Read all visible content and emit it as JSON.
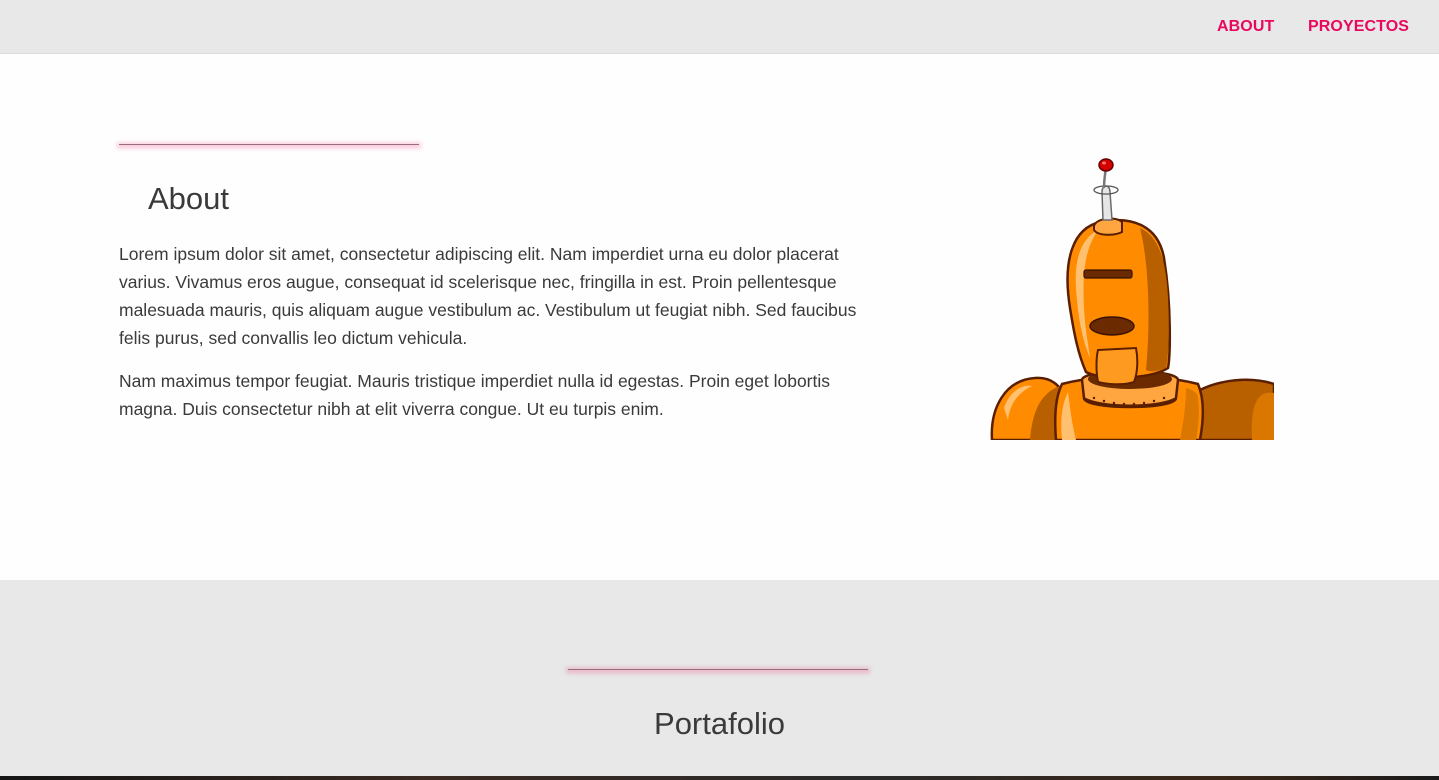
{
  "nav": {
    "links": [
      {
        "label": "ABOUT"
      },
      {
        "label": "PROYECTOS"
      }
    ],
    "link_color": "#e8085e",
    "background": "#e8e8e8"
  },
  "about": {
    "title": "About",
    "paragraphs": [
      "Lorem ipsum dolor sit amet, consectetur adipiscing elit. Nam imperdiet urna eu dolor placerat varius. Vivamus eros augue, consequat id scelerisque nec, fringilla in est. Proin pellentesque malesuada mauris, quis aliquam augue vestibulum ac. Vestibulum ut feugiat nibh. Sed faucibus felis purus, sed convallis leo dictum vehicula.",
      "Nam maximus tempor feugiat. Mauris tristique imperdiet nulla id egestas. Proin eget lobortis magna. Duis consectetur nibh at elit viverra congue. Ut eu turpis enim."
    ],
    "image": "robot-illustration"
  },
  "portfolio": {
    "title": "Portafolio"
  },
  "colors": {
    "accent": "#e8085e",
    "text": "#3a3a3a",
    "section_light": "#fefefe",
    "section_gray": "#e8e8e8",
    "robot_orange": "#ff8c00"
  }
}
